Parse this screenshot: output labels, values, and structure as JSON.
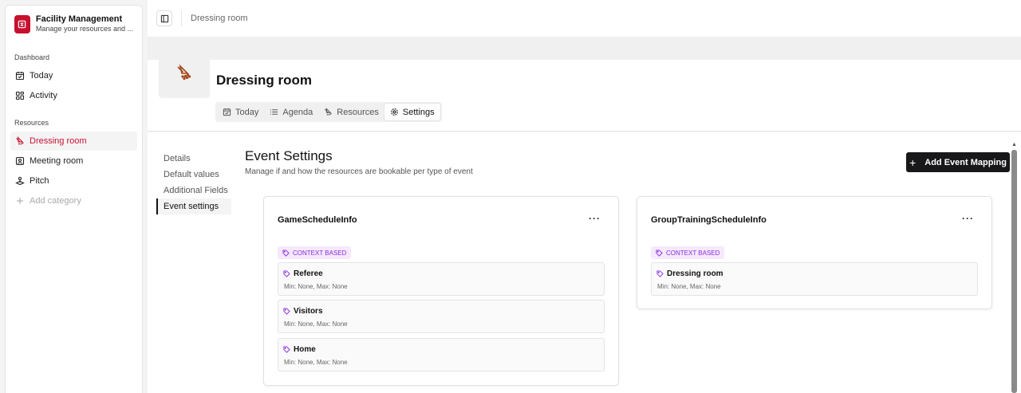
{
  "brand": {
    "title": "Facility Management",
    "subtitle": "Manage your resources and ...",
    "color": "#c8102e"
  },
  "sidebar": {
    "dashboard_label": "Dashboard",
    "dashboard_items": [
      {
        "label": "Today",
        "icon": "calendar-icon"
      },
      {
        "label": "Activity",
        "icon": "grid-icon"
      }
    ],
    "resources_label": "Resources",
    "resource_items": [
      {
        "label": "Dressing room",
        "icon": "shower-icon",
        "active": true
      },
      {
        "label": "Meeting room",
        "icon": "meeting-icon"
      },
      {
        "label": "Pitch",
        "icon": "joystick-icon"
      }
    ],
    "add_category": "Add category"
  },
  "topbar": {
    "breadcrumb": "Dressing room"
  },
  "header": {
    "title": "Dressing room",
    "tabs": [
      {
        "label": "Today",
        "icon": "calendar-icon"
      },
      {
        "label": "Agenda",
        "icon": "list-icon"
      },
      {
        "label": "Resources",
        "icon": "shower-icon"
      },
      {
        "label": "Settings",
        "icon": "gear-icon",
        "active": true
      }
    ]
  },
  "subnav": {
    "items": [
      "Details",
      "Default values",
      "Additional Fields",
      "Event settings"
    ],
    "active": "Event settings"
  },
  "event_settings": {
    "title": "Event Settings",
    "subtitle": "Manage if and how the resources are bookable per type of event",
    "add_button": "Add Event Mapping",
    "cards": [
      {
        "title": "GameScheduleInfo",
        "badge": "CONTEXT BASED",
        "items": [
          {
            "name": "Referee",
            "meta": "Min: None, Max: None"
          },
          {
            "name": "Visitors",
            "meta": "Min: None, Max: None"
          },
          {
            "name": "Home",
            "meta": "Min: None, Max: None"
          }
        ]
      },
      {
        "title": "GroupTrainingScheduleInfo",
        "badge": "CONTEXT BASED",
        "items": [
          {
            "name": "Dressing room",
            "meta": "Min: None, Max: None"
          }
        ]
      }
    ]
  }
}
